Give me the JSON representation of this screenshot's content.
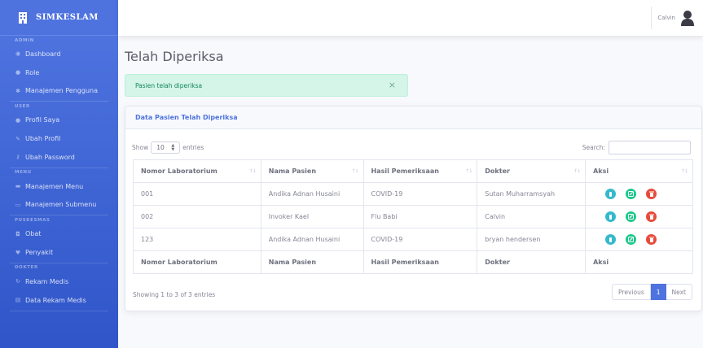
{
  "brand": {
    "name": "SIMKESLAM",
    "icon": "building-icon"
  },
  "sidebar": {
    "sections": [
      {
        "heading": "ADMIN",
        "items": [
          {
            "label": "Dashboard",
            "icon": "dashboard-icon"
          },
          {
            "label": "Role",
            "icon": "user-icon"
          },
          {
            "label": "Manajemen Pengguna",
            "icon": "users-icon"
          }
        ]
      },
      {
        "heading": "USER",
        "items": [
          {
            "label": "Profil Saya",
            "icon": "user-icon"
          },
          {
            "label": "Ubah Profil",
            "icon": "user-edit-icon"
          },
          {
            "label": "Ubah Password",
            "icon": "key-icon"
          }
        ]
      },
      {
        "heading": "MENU",
        "items": [
          {
            "label": "Manajemen Menu",
            "icon": "folder-icon"
          },
          {
            "label": "Manajemen Submenu",
            "icon": "folder-open-icon"
          }
        ]
      },
      {
        "heading": "PUSKESMAS",
        "items": [
          {
            "label": "Obat",
            "icon": "pill-icon"
          },
          {
            "label": "Penyakit",
            "icon": "heart-icon"
          }
        ]
      },
      {
        "heading": "DOKTER",
        "items": [
          {
            "label": "Rekam Medis",
            "icon": "stethoscope-icon"
          },
          {
            "label": "Data Rekam Medis",
            "icon": "file-icon"
          }
        ]
      }
    ]
  },
  "topbar": {
    "user_name": "Calvin"
  },
  "page": {
    "title": "Telah Diperiksa"
  },
  "alert": {
    "message": "Pasien telah diperiksa",
    "close": "×"
  },
  "card": {
    "header": "Data Pasien Telah Diperiksa",
    "length": {
      "show": "Show",
      "value": "10",
      "entries": "entries"
    },
    "search_label": "Search:",
    "columns": [
      "Nomor Laboratorium",
      "Nama Pasien",
      "Hasil Pemeriksaan",
      "Dokter",
      "Aksi"
    ],
    "rows": [
      {
        "nomor": "001",
        "nama": "Andika Adnan Husaini",
        "hasil": "COVID-19",
        "dokter": "Sutan Muharramsyah"
      },
      {
        "nomor": "002",
        "nama": "Invoker Kael",
        "hasil": "Flu Babi",
        "dokter": "Calvin"
      },
      {
        "nomor": "123",
        "nama": "Andika Adnan Husaini",
        "hasil": "COVID-19",
        "dokter": "bryan hendersen"
      }
    ],
    "info": "Showing 1 to 3 of 3 entries",
    "pager": {
      "previous": "Previous",
      "current": "1",
      "next": "Next"
    }
  },
  "colors": {
    "primary": "#4e73df",
    "info": "#36b9cc",
    "success": "#1cc88a",
    "danger": "#e74a3b",
    "alert_bg": "#d4f5e8"
  }
}
